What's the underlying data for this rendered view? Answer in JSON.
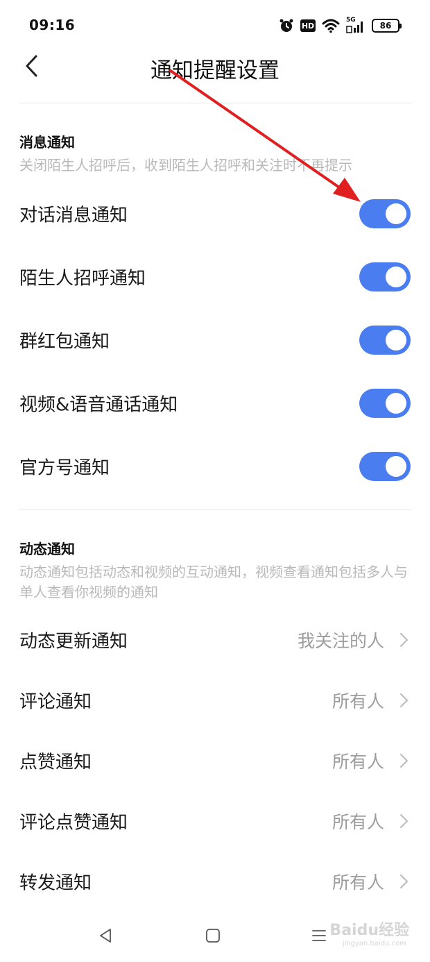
{
  "status": {
    "time": "09:16",
    "hd": "HD",
    "net": "5G",
    "battery": "86"
  },
  "header": {
    "title": "通知提醒设置"
  },
  "sections": [
    {
      "title": "消息通知",
      "desc": "关闭陌生人招呼后，收到陌生人招呼和关注时不再提示",
      "rows": [
        {
          "label": "对话消息通知",
          "on": true
        },
        {
          "label": "陌生人招呼通知",
          "on": true
        },
        {
          "label": "群红包通知",
          "on": true
        },
        {
          "label": "视频&语音通话通知",
          "on": true
        },
        {
          "label": "官方号通知",
          "on": true
        }
      ]
    },
    {
      "title": "动态通知",
      "desc": "动态通知包括动态和视频的互动通知，视频查看通知包括多人与单人查看你视频的通知",
      "rows": [
        {
          "label": "动态更新通知",
          "value": "我关注的人"
        },
        {
          "label": "评论通知",
          "value": "所有人"
        },
        {
          "label": "点赞通知",
          "value": "所有人"
        },
        {
          "label": "评论点赞通知",
          "value": "所有人"
        },
        {
          "label": "转发通知",
          "value": "所有人"
        }
      ]
    }
  ],
  "watermark": {
    "brand": "Baidu经验",
    "url": "jingyan.baidu.com"
  },
  "colors": {
    "accent": "#4a7ef0",
    "arrow": "#e02020"
  },
  "icons": {
    "back": "chevron-left-icon",
    "alarm": "alarm-clock-icon",
    "wifi": "wifi-icon",
    "signal": "signal-icon",
    "nav_back": "triangle-back-icon",
    "nav_home": "square-home-icon",
    "nav_menu": "menu-lines-icon"
  }
}
